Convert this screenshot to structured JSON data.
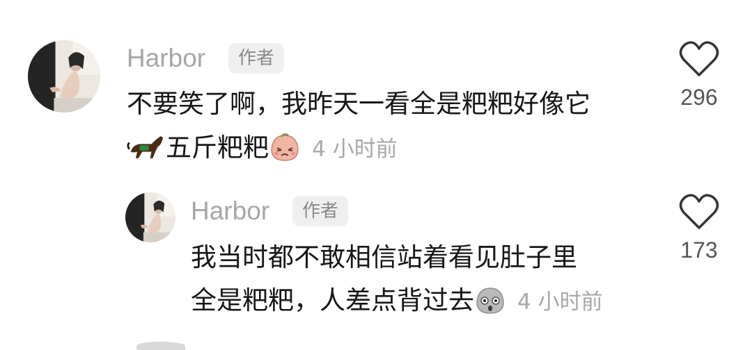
{
  "comments": [
    {
      "username": "Harbor",
      "badge": "作者",
      "text_line1": "不要笑了啊，我昨天一看全是粑粑好像它",
      "text_line2": "五斤粑粑",
      "timestamp": "4 小时前",
      "likes": "296",
      "leading_icon": "horse-emoji-icon",
      "trailing_icon": "crying-peach-emoji-icon"
    },
    {
      "username": "Harbor",
      "badge": "作者",
      "text_line1": "我当时都不敢相信站着看见肚子里",
      "text_line2": "全是粑粑，人差点背过去",
      "timestamp": "4 小时前",
      "likes": "173",
      "trailing_icon": "shocked-gray-emoji-icon"
    }
  ],
  "colors": {
    "username": "#a6a6a6",
    "badge_bg": "#efefef",
    "body_text": "#161616",
    "meta_text": "#a8a8a8",
    "like_icon": "#333333"
  }
}
